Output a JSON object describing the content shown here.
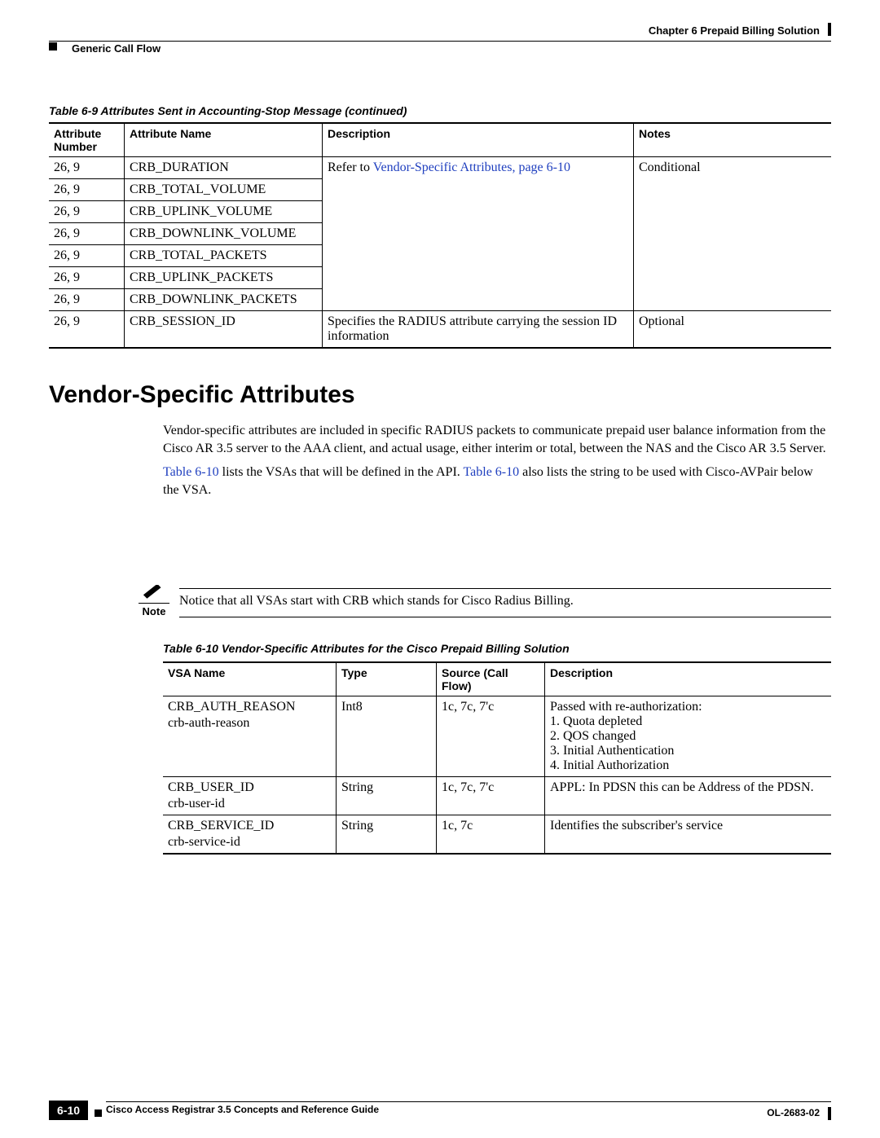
{
  "header": {
    "chapter": "Chapter 6    Prepaid Billing Solution",
    "section": "Generic Call Flow"
  },
  "table69": {
    "caption": "Table 6-9    Attributes Sent in Accounting-Stop Message  (continued)",
    "headers": {
      "c1": "Attribute Number",
      "c2": "Attribute Name",
      "c3": "Description",
      "c4": "Notes"
    },
    "desc_link_pre": "Refer to ",
    "desc_link_text": "Vendor-Specific Attributes, page 6-10",
    "rows": [
      {
        "num": "26, 9",
        "name": "CRB_DURATION",
        "notes": "Conditional"
      },
      {
        "num": "26, 9",
        "name": "CRB_TOTAL_VOLUME"
      },
      {
        "num": "26, 9",
        "name": "CRB_UPLINK_VOLUME"
      },
      {
        "num": "26, 9",
        "name": "CRB_DOWNLINK_VOLUME"
      },
      {
        "num": "26, 9",
        "name": "CRB_TOTAL_PACKETS"
      },
      {
        "num": "26, 9",
        "name": "CRB_UPLINK_PACKETS"
      },
      {
        "num": "26, 9",
        "name": "CRB_DOWNLINK_PACKETS"
      }
    ],
    "last": {
      "num": "26, 9",
      "name": "CRB_SESSION_ID",
      "desc": "Specifies the RADIUS attribute carrying the session ID information",
      "notes": "Optional"
    }
  },
  "section_title": "Vendor-Specific Attributes",
  "body": {
    "p1": "Vendor-specific attributes are included in specific RADIUS packets to communicate prepaid user balance information from the Cisco AR 3.5 server to the AAA client, and actual usage, either interim or total, between the NAS and the Cisco AR 3.5 Server.",
    "p2_pre": "",
    "p2_link1": "Table 6-10",
    "p2_mid": " lists the VSAs that will be defined in the API. ",
    "p2_link2": "Table 6-10",
    "p2_post": " also lists the string to be used with Cisco-AVPair below the VSA."
  },
  "note": {
    "label": "Note",
    "text": "Notice that all VSAs start with CRB which stands for Cisco Radius Billing."
  },
  "table610": {
    "caption": "Table 6-10    Vendor-Specific Attributes for the Cisco Prepaid Billing Solution",
    "headers": {
      "c1": "VSA Name",
      "c2": "Type",
      "c3": "Source (Call Flow)",
      "c4": "Description"
    },
    "rows": [
      {
        "name": "CRB_AUTH_REASON",
        "sub": "crb-auth-reason",
        "type": "Int8",
        "src": "1c, 7c, 7'c",
        "desc": "Passed with re-authorization:\n1. Quota depleted\n2. QOS changed\n3. Initial Authentication\n4. Initial Authorization"
      },
      {
        "name": "CRB_USER_ID",
        "sub": "crb-user-id",
        "type": "String",
        "src": "1c, 7c, 7'c",
        "desc": "APPL: In PDSN this can be Address of the PDSN."
      },
      {
        "name": "CRB_SERVICE_ID",
        "sub": "crb-service-id",
        "type": "String",
        "src": "1c, 7c",
        "desc": "Identifies the subscriber's service"
      }
    ]
  },
  "footer": {
    "title": "Cisco Access Registrar 3.5 Concepts and Reference Guide",
    "page": "6-10",
    "doc": "OL-2683-02"
  }
}
